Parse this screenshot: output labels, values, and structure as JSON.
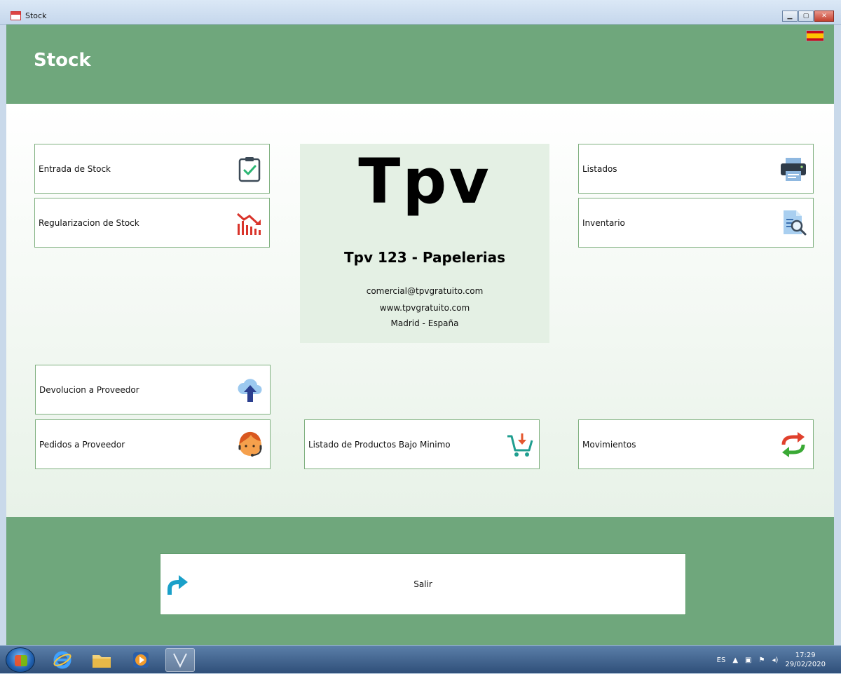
{
  "window": {
    "title": "Stock"
  },
  "header": {
    "title": "Stock"
  },
  "tiles": {
    "entrada": "Entrada de Stock",
    "regularizacion": "Regularizacion de Stock",
    "listados": "Listados",
    "inventario": "Inventario",
    "devolucion": "Devolucion a Proveedor",
    "pedidos": "Pedidos a Proveedor",
    "bajo_minimo": "Listado de Productos Bajo Minimo",
    "movimientos": "Movimientos"
  },
  "info": {
    "logo": "Tpv",
    "product": "Tpv 123 - Papelerias",
    "email": "comercial@tpvgratuito.com",
    "web": "www.tpvgratuito.com",
    "location": "Madrid - España"
  },
  "footer": {
    "exit_label": "Salir"
  },
  "taskbar": {
    "language": "ES",
    "time": "17:29",
    "date": "29/02/2020"
  },
  "colors": {
    "header_green": "#6fa77c",
    "tile_border": "#7fb07f",
    "panel_bg": "#e4f0e4"
  }
}
